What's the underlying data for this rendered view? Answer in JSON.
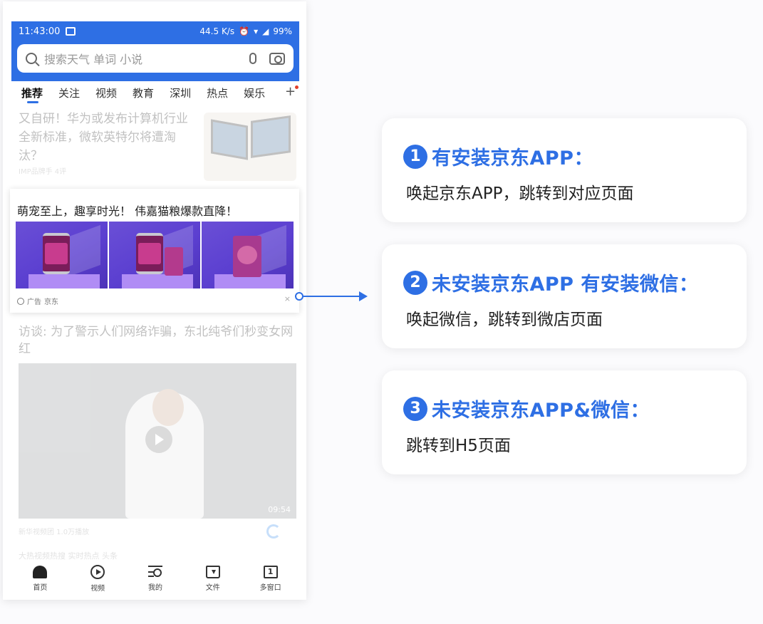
{
  "status": {
    "time": "11:43:00",
    "speed": "44.5 K/s",
    "battery": "99%"
  },
  "search": {
    "placeholder": "搜索天气 单词 小说",
    "icon": "search-icon"
  },
  "tabs": [
    "推荐",
    "关注",
    "视频",
    "教育",
    "深圳",
    "热点",
    "娱乐"
  ],
  "tabs_more": "+",
  "news1": {
    "title": "又自研！华为或发布计算机行业全新标准，微软英特尔将遭淘汰？",
    "meta": "IMP品牌手 4评"
  },
  "ad": {
    "title": "萌宠至上，趣享时光！ 伟嘉猫粮爆款直降！",
    "label": "广告",
    "source": "京东",
    "close": "×"
  },
  "news2": {
    "title": "访谈: 为了警示人们网络诈骗，东北纯爷们秒变女网红",
    "meta": "新华视频团 1.0万播放",
    "duration": "09:54"
  },
  "news3": {
    "title": "大热视频热搜 实时热点 头条"
  },
  "bottom_nav": [
    {
      "label": "首页",
      "icon": "home-icon"
    },
    {
      "label": "视频",
      "icon": "video-icon"
    },
    {
      "label": "我的",
      "icon": "profile-icon"
    },
    {
      "label": "文件",
      "icon": "file-icon"
    },
    {
      "label": "多窗口",
      "icon": "window-icon",
      "count": "1"
    }
  ],
  "cards": [
    {
      "num": "1",
      "title": "有安装京东APP：",
      "desc": "唤起京东APP，跳转到对应页面"
    },
    {
      "num": "2",
      "title": "未安装京东APP 有安装微信：",
      "desc": "唤起微信，跳转到微店页面"
    },
    {
      "num": "3",
      "title": "未安装京东APP&微信：",
      "desc": "跳转到H5页面"
    }
  ],
  "colors": {
    "accent": "#2e6fe4",
    "ad_purple": "#5b3fd0"
  }
}
